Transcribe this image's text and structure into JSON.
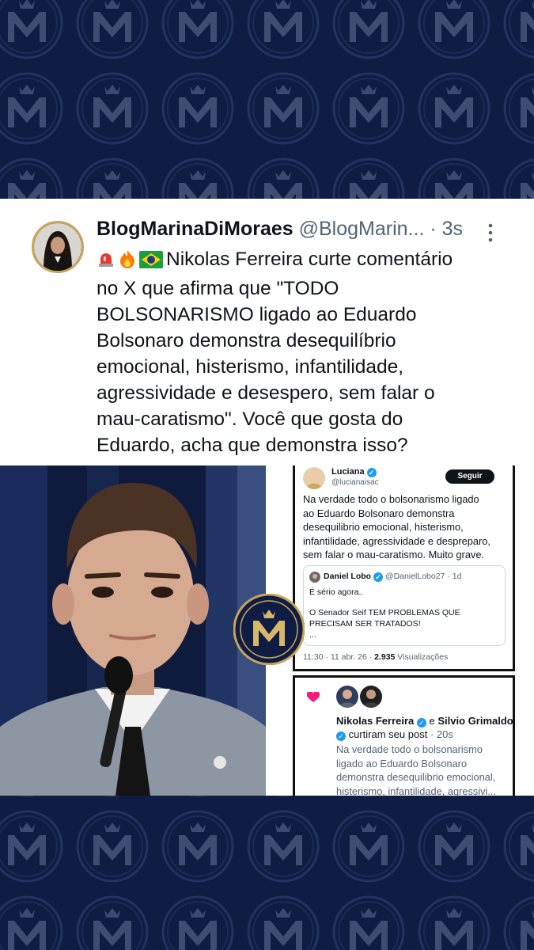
{
  "tweet": {
    "display_name": "BlogMarinaDiMoraes",
    "handle": "@BlogMarin...",
    "separator": "·",
    "age": "3s",
    "text_lines": [
      "Nikolas Ferreira curte comentário",
      "no X que afirma que \"TODO",
      "BOLSONARISMO ligado ao Eduardo",
      "Bolsonaro demonstra desequilíbrio",
      "emocional, histerismo, infantilidade,",
      "agressividade e desespero, sem falar o",
      "mau-caratismo\". Você que gosta do",
      "Eduardo, acha que demonstra isso?"
    ],
    "emojis": [
      "siren-emoji",
      "fire-emoji",
      "brazil-flag-emoji"
    ]
  },
  "embedded_post": {
    "author_name": "Luciana",
    "author_handle": "@lucianaisac",
    "follow_label": "Seguir",
    "body_lines": [
      "Na verdade todo o bolsonarismo ligado",
      "ao Eduardo Bolsonaro demonstra",
      "desequilibrio emocional, histerismo,",
      "infantilidade, agressividade e despreparo,",
      "sem falar o mau-caratismo. Muito grave."
    ],
    "quote": {
      "author_name": "Daniel Lobo",
      "author_handle": "@DanielLobo27",
      "separator": "·",
      "age": "1d",
      "line1": "É sério agora..",
      "line2": "O Senador Seif TEM PROBLEMAS QUE",
      "line3": "PRECISAM SER TRATADOS!",
      "line4": "..."
    },
    "timestamp": "11:30 · 11 abr. 26 ·",
    "views_count": "2.935",
    "views_label": "Visualizações"
  },
  "like_notification": {
    "name1": "Nikolas Ferreira",
    "joiner": "e",
    "name2": "Silvio Grimaldo",
    "action": "curtiram seu post",
    "separator": "·",
    "age": "20s",
    "body_lines": [
      "Na verdade todo o bolsonarismo",
      "ligado ao Eduardo Bolsonaro",
      "demonstra desequilibrio emocional,",
      "histerismo, infantilidade, agressivi..."
    ]
  },
  "colors": {
    "navy": "#0f1d44",
    "gold": "#c9a45a",
    "verified": "#1d9bf0",
    "heart": "#f91880"
  }
}
